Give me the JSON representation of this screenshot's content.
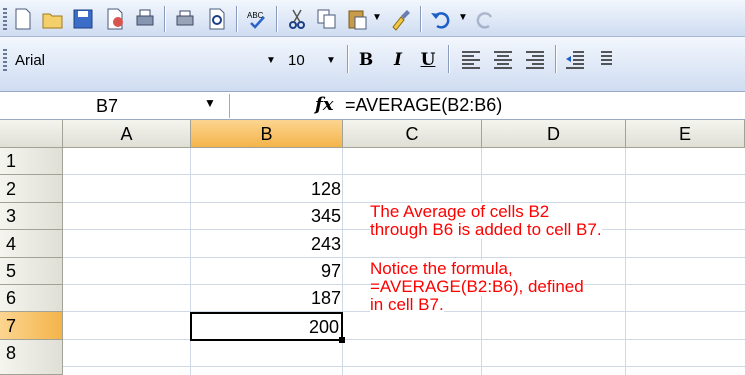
{
  "standard_toolbar": {
    "buttons": [
      "new-icon",
      "open-icon",
      "save-icon",
      "permission-icon",
      "print-icon",
      "print-preview-icon",
      "preview-icon",
      "spelling-icon",
      "cut-icon",
      "copy-icon",
      "paste-icon",
      "format-painter-icon",
      "undo-icon",
      "redo-icon"
    ]
  },
  "formatting_toolbar": {
    "font_name": "Arial",
    "font_size": "10",
    "bold_label": "B",
    "italic_label": "I",
    "underline_label": "U"
  },
  "formula_bar": {
    "name_box": "B7",
    "fx_label": "fx",
    "formula": "=AVERAGE(B2:B6)"
  },
  "sheet": {
    "columns": [
      "A",
      "B",
      "C",
      "D",
      "E"
    ],
    "rows": [
      "1",
      "2",
      "3",
      "4",
      "5",
      "6",
      "7",
      "8"
    ],
    "selected_column": "B",
    "selected_row": "7",
    "b_values": [
      "",
      "128",
      "345",
      "243",
      "97",
      "187",
      "200",
      ""
    ]
  },
  "notes": {
    "line1": "The Average of cells B2",
    "line2": "through B6 is added to cell B7.",
    "line3": "Notice the formula,",
    "line4": "=AVERAGE(B2:B6), defined",
    "line5": "in cell B7."
  },
  "colors": {
    "toolbar": "#cfdcf1",
    "selected_header": "#f4b44a",
    "note_text": "#ff0000"
  }
}
